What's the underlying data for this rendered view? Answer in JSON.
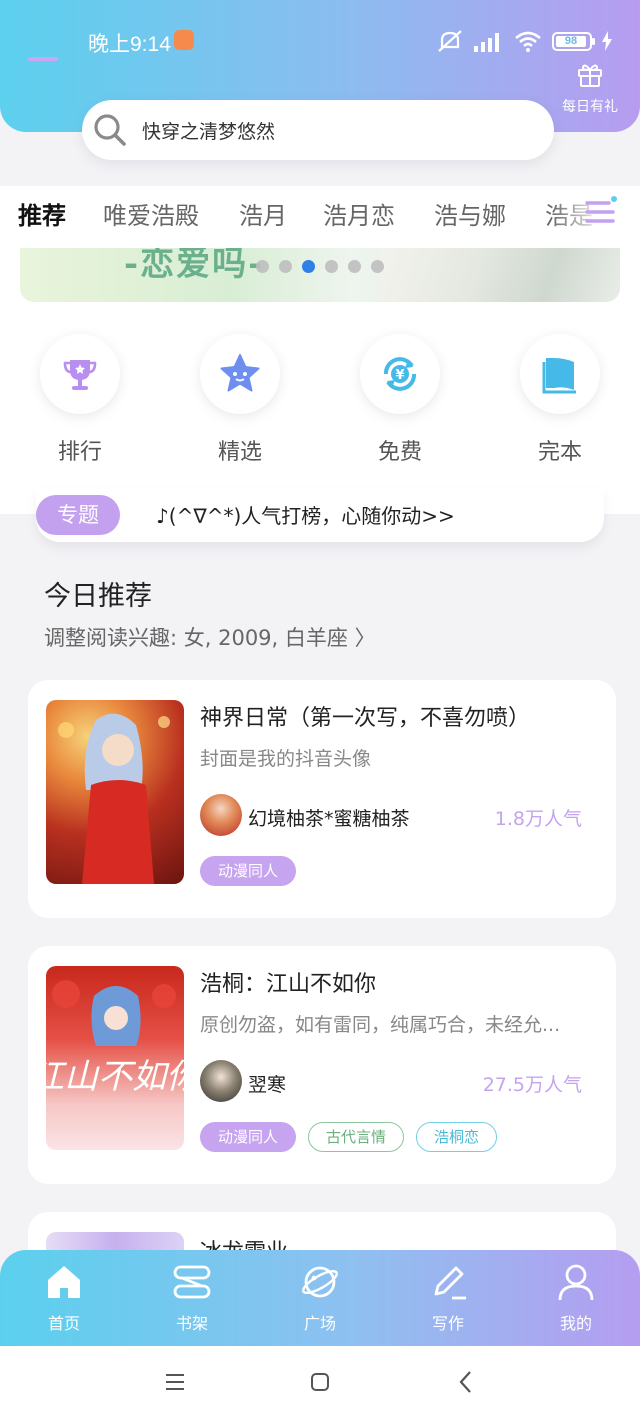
{
  "status_bar": {
    "time": "晚上9:14",
    "battery": "98"
  },
  "gift": {
    "label": "每日有礼"
  },
  "search": {
    "text": "快穿之清梦悠然"
  },
  "tabs": [
    "推荐",
    "唯爱浩殿",
    "浩月",
    "浩月恋",
    "浩与娜",
    "浩是"
  ],
  "banner": {
    "text": "-恋爱吗-"
  },
  "features": [
    {
      "label": "排行",
      "icon": "trophy-icon"
    },
    {
      "label": "精选",
      "icon": "star-icon"
    },
    {
      "label": "免费",
      "icon": "yen-refresh-icon"
    },
    {
      "label": "完本",
      "icon": "book-icon"
    }
  ],
  "topic": {
    "badge": "专题",
    "text": "♪(^∇^*)人气打榜，心随你动>>"
  },
  "recommend": {
    "title": "今日推荐",
    "subtitle": "调整阅读兴趣: 女, 2009, 白羊座 〉"
  },
  "books": [
    {
      "title": "神界日常（第一次写，不喜勿喷）",
      "desc": "封面是我的抖音头像",
      "author": "幻境柚茶*蜜糖柚茶",
      "popularity": "1.8万人气",
      "tags": [
        "动漫同人"
      ]
    },
    {
      "title": "浩桐：江山不如你",
      "desc": "原创勿盗，如有雷同，纯属巧合，未经允...",
      "author": "翌寒",
      "popularity": "27.5万人气",
      "tags": [
        "动漫同人",
        "古代言情",
        "浩桐恋"
      ],
      "cover_text": "江山不如你"
    },
    {
      "title": "冰龙雷业"
    }
  ],
  "bottom_nav": [
    "首页",
    "书架",
    "广场",
    "写作",
    "我的"
  ],
  "colors": {
    "accent": "#c3a1ef",
    "header_start": "#5cd0ee",
    "header_end": "#b79cf0"
  }
}
